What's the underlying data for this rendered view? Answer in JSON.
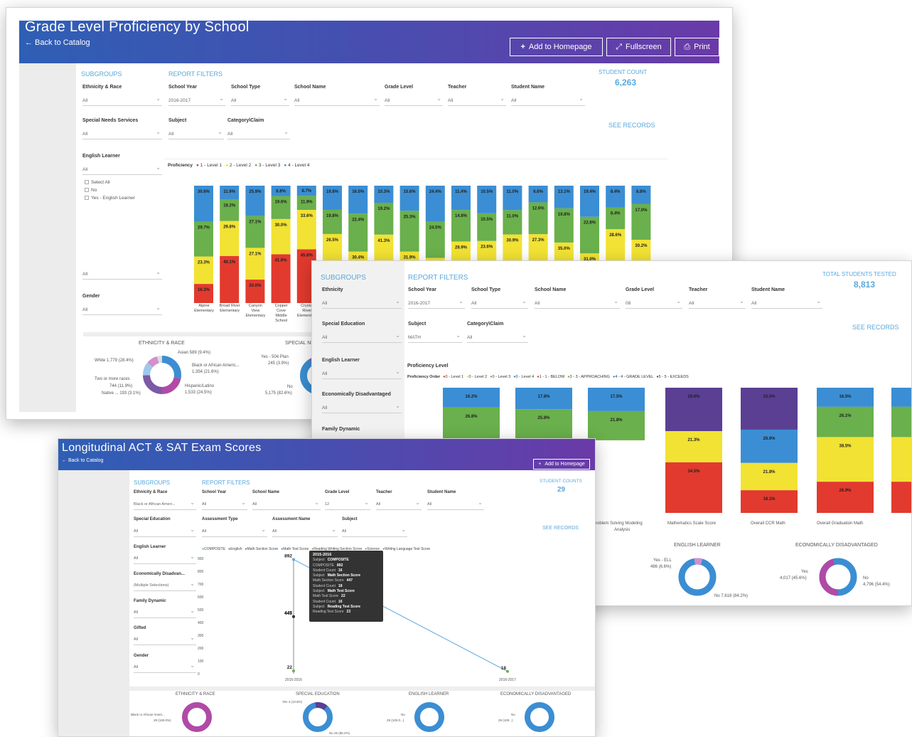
{
  "colors": {
    "level1": "#e23a2e",
    "level2": "#f2e233",
    "level3": "#6ab04c",
    "level4": "#3b8ed3",
    "exceeds": "#5a3f93",
    "accent": "#5aa8dc",
    "donut_purple": "#b04aa6"
  },
  "w1": {
    "title": "Grade Level Proficiency by School",
    "back": "Back to Catalog",
    "buttons": {
      "add": "Add to Homepage",
      "full": "Fullscreen",
      "print": "Print"
    },
    "subgroups": "SUBGROUPS",
    "report_filters": "REPORT FILTERS",
    "student_count_label": "STUDENT COUNT",
    "student_count": "6,263",
    "see_records": "SEE RECORDS",
    "labels": {
      "eth": "Ethnicity & Race",
      "year": "School Year",
      "type": "School Type",
      "name": "School Name",
      "grade": "Grade Level",
      "teacher": "Teacher",
      "student": "Student Name",
      "sns": "Special Needs Services",
      "subject": "Subject",
      "cat": "Category\\Claim",
      "el": "English Learner",
      "gender": "Gender"
    },
    "values": {
      "eth": "All",
      "year": "2016-2017",
      "type": "All",
      "name": "All",
      "grade": "All",
      "teacher": "All",
      "student": "All",
      "sns": "All",
      "subject": "All",
      "cat": "All",
      "el": "All",
      "el2": "All",
      "gender": "All"
    },
    "el_options": [
      "Select All",
      "No",
      "Yes - English Learner"
    ],
    "legend_title": "Proficiency",
    "legend": [
      "1 - Level 1",
      "2 - Level 2",
      "3 - Level 3",
      "4 - Level 4"
    ],
    "school_labels": [
      [
        "Alpine",
        "Elementary"
      ],
      [
        "Broad River",
        "Elementary"
      ],
      [
        "Canyon",
        "View",
        "Elementary"
      ],
      [
        "Copper",
        "Cove",
        "Middle",
        "School"
      ],
      [
        "Crystal",
        "River",
        "Elementary"
      ]
    ],
    "bottom": {
      "eth_title": "ETHNICITY & RACE",
      "sn_title": "SPECIAL NE",
      "eth_labels": [
        "White 1,779 (28.4%)",
        "Two or more races",
        "744 (11.9%)",
        "Native ... 193 (3.1%)",
        "Asian 589 (9.4%)",
        "Black or African Americ...",
        "1,354 (21.6%)",
        "Hispanic/Latino",
        "1,533 (24.5%)"
      ],
      "sn_labels": [
        "Yes - 504 Plan",
        "245 (3.9%)",
        "No",
        "5,175 (82.6%)"
      ]
    }
  },
  "w2": {
    "subgroups": "SUBGROUPS",
    "report_filters": "REPORT FILTERS",
    "count_label": "TOTAL STUDENTS TESTED",
    "count": "8,813",
    "see_records": "SEE RECORDS",
    "labels": {
      "eth": "Ethnicity",
      "year": "School Year",
      "type": "School Type",
      "name": "School Name",
      "grade": "Grade Level",
      "teacher": "Teacher",
      "student": "Student Name",
      "sped": "Special Education",
      "subject": "Subject",
      "cat": "Category\\Claim",
      "el": "English Learner",
      "econ": "Economically Disadvantaged",
      "family": "Family Dynamic"
    },
    "values": {
      "eth": "All",
      "year": "2016-2017",
      "type": "All",
      "name": "All",
      "grade": "08",
      "teacher": "All",
      "student": "All",
      "sped": "All",
      "subject": "MATH",
      "cat": "All",
      "el": "All",
      "econ": "All"
    },
    "prof_title": "Proficiency Level",
    "prof_order": "Proficiency Order",
    "legend": [
      "0 - Level 1",
      "0 - Level 2",
      "0 - Level 3",
      "0 - Level 4",
      "1 - 1 - BELOW",
      "3 - 3 - APPROACHING",
      "4 - 4 - GRADE LEVEL",
      "5 - 5 - EXCEEDS"
    ],
    "xlabels": [
      [
        "Problem Solving Modeling",
        "Analysis"
      ],
      [
        "Mathematics Scale Score"
      ],
      [
        "Overall CCR Math"
      ],
      [
        "Overall Graduation Math"
      ]
    ],
    "el_title": "ENGLISH LEARNER",
    "econ_title": "ECONOMICALLY DISADVANTAGED",
    "el_labels": [
      "Yes - ELL",
      "486 (6.6%)",
      "No 7,618 (84.2%)"
    ],
    "econ_labels": [
      "Yes",
      "4,017 (45.6%)",
      "No",
      "4,796 (54.4%)"
    ]
  },
  "w3": {
    "title": "Longitudinal ACT & SAT Exam Scores",
    "back": "Back to Catalog",
    "add": "Add to Homepage",
    "subgroups": "SUBGROUPS",
    "report_filters": "REPORT FILTERS",
    "count_label": "STUDENT COUNTS",
    "count": "29",
    "see_records": "SEE RECORDS",
    "labels": {
      "eth": "Ethnicity & Race",
      "year": "School Year",
      "name": "School Name",
      "grade": "Grade Level",
      "teacher": "Teacher",
      "student": "Student Name",
      "sped": "Special Education",
      "atype": "Assessment Type",
      "aname": "Assessment Name",
      "subject": "Subject",
      "el": "English Learner",
      "econ": "Economically Disadvan...",
      "family": "Family Dynamic",
      "gifted": "Gifted",
      "gender": "Gender"
    },
    "values": {
      "eth": "Black or African Ameri...",
      "year": "All",
      "name": "All",
      "grade": "12",
      "teacher": "All",
      "student": "All",
      "sped": "All",
      "atype": "All",
      "aname": "All",
      "subject": "All",
      "el": "All",
      "econ": "(Multiple Selections)",
      "family": "All",
      "gifted": "All",
      "gender": "All"
    },
    "legend": [
      "COMPOSITE",
      "English",
      "Math Section Score",
      "Math Test Score",
      "Reading Writing Section Score",
      "Science",
      "Writing Language Test Score"
    ],
    "yticks": [
      "900",
      "800",
      "700",
      "600",
      "500",
      "400",
      "300",
      "200",
      "100",
      "0"
    ],
    "xticks": [
      "2015-2016",
      "2016-2017"
    ],
    "point_labels": [
      "892",
      "447",
      "445",
      "22",
      "18"
    ],
    "tooltip": {
      "year": "2015-2016",
      "rows": [
        [
          "Subject",
          "COMPOSITE"
        ],
        [
          "COMPOSITE",
          "892"
        ],
        [
          "Student Count",
          "16"
        ],
        [
          "Subject",
          "Math Section Score"
        ],
        [
          "Math Section Score",
          "447"
        ],
        [
          "Student Count",
          "18"
        ],
        [
          "Subject",
          "Math Test Score"
        ],
        [
          "Math Test Score",
          "22"
        ],
        [
          "Student Count",
          "16"
        ],
        [
          "Subject",
          "Reading Test Score"
        ],
        [
          "Reading Test Score",
          "23"
        ]
      ]
    },
    "bottom": {
      "t1": "ETHNICITY & RACE",
      "t2": "SPECIAL EDUCATION",
      "t3": "ENGLISH LEARNER",
      "t4": "ECONOMICALLY DISADVANTAGED",
      "l1": [
        "Black or African Ameri...",
        "29 (100.0%)"
      ],
      "l2": [
        "Yes 4 (13.8%)",
        "No 25 (86.2%)"
      ],
      "l3": [
        "No",
        "29 (100.0...)"
      ],
      "l4": [
        "No",
        "29 (100...)"
      ]
    }
  },
  "chart_data": [
    {
      "type": "bar",
      "title": "Grade Level Proficiency by School",
      "stacked": true,
      "legend": [
        "1 - Level 1",
        "2 - Level 2",
        "3 - Level 3",
        "4 - Level 4"
      ],
      "series": [
        {
          "name": "1 - Level 1",
          "values": [
            16.3,
            40.1,
            20.0,
            41.6,
            45.8,
            30.1,
            null,
            null,
            null,
            null,
            null,
            null,
            null,
            null,
            null,
            null,
            null,
            null
          ]
        },
        {
          "name": "2 - Level 2",
          "values": [
            23.3,
            29.8,
            27.1,
            30.0,
            33.6,
            26.5,
            30.4,
            41.3,
            31.9,
            30.6,
            28.9,
            23.6,
            30.9,
            27.3,
            35.0,
            31.0,
            28.6,
            30.2
          ]
        },
        {
          "name": "3 - Level 3",
          "values": [
            29.7,
            18.2,
            27.1,
            19.6,
            11.9,
            19.8,
            22.4,
            19.2,
            25.3,
            24.5,
            14.8,
            10.5,
            11.0,
            12.6,
            19.8,
            22.8,
            8.4,
            17.0
          ]
        },
        {
          "name": "4 - Level 4",
          "values": [
            30.6,
            11.9,
            25.9,
            8.8,
            8.7,
            19.8,
            16.5,
            10.3,
            15.6,
            24.4,
            11.4,
            10.5,
            11.0,
            6.6,
            13.1,
            19.4,
            8.4,
            8.8
          ]
        }
      ]
    },
    {
      "type": "bar",
      "stacked": true,
      "categories": [
        "",
        "",
        "",
        "Problem Solving Modeling Analysis",
        "Mathematics Scale Score",
        "Overall CCR Math",
        "Overall Graduation Math"
      ],
      "series": [
        {
          "name": "1 - 1 - BELOW",
          "values": [
            null,
            null,
            null,
            34.5,
            18.1,
            26.9,
            26.9
          ]
        },
        {
          "name": "3 - 3 - APPROACHING",
          "values": [
            null,
            null,
            null,
            21.3,
            21.8,
            38.5,
            38.5
          ]
        },
        {
          "name": "4 - 4 - GRADE LEVEL",
          "values": [
            26.8,
            25.8,
            21.8,
            29.6,
            26.6,
            26.1,
            26.1
          ]
        },
        {
          "name": "5 - 5 - EXCEEDS",
          "values": [
            16.2,
            17.8,
            17.5,
            null,
            33.5,
            16.5,
            16.5
          ]
        }
      ]
    },
    {
      "type": "line",
      "title": "Longitudinal ACT & SAT Exam Scores",
      "x": [
        "2015-2016",
        "2016-2017"
      ],
      "ylim": [
        0,
        900
      ],
      "series": [
        {
          "name": "COMPOSITE",
          "values": [
            892,
            18
          ]
        },
        {
          "name": "Math Section Score",
          "values": [
            447,
            null
          ]
        },
        {
          "name": "Math Test Score",
          "values": [
            445,
            null
          ]
        },
        {
          "name": "English",
          "values": [
            22,
            null
          ]
        }
      ]
    }
  ]
}
